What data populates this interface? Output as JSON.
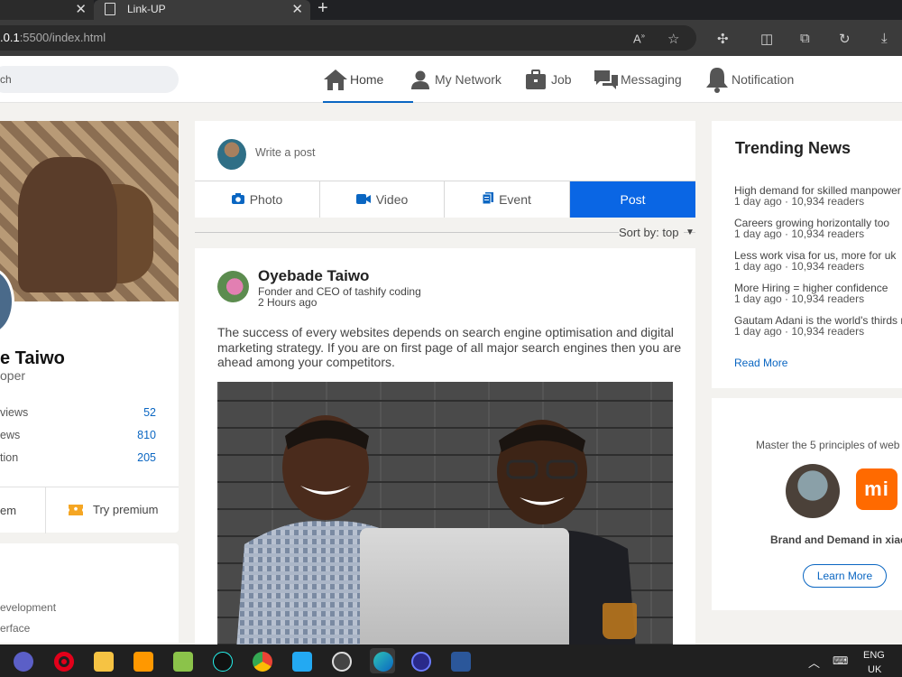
{
  "browser": {
    "tab_title": "Link-UP",
    "url_host": ".0.1",
    "url_rest": ":5500/index.html"
  },
  "search": {
    "placeholder": "ch"
  },
  "nav": {
    "home": "Home",
    "network": "My Network",
    "job": "Job",
    "messaging": "Messaging",
    "notification": "Notification"
  },
  "profile": {
    "name": "e Taiwo",
    "role": "oper",
    "stats": [
      {
        "label": "views",
        "value": "52"
      },
      {
        "label": "ews",
        "value": "810"
      },
      {
        "label": "tion",
        "value": "205"
      }
    ],
    "items_label": "em",
    "premium_label": "Try premium",
    "skills": [
      "evelopment",
      "erface"
    ]
  },
  "composer": {
    "placeholder": "Write a post",
    "photo": "Photo",
    "video": "Video",
    "event": "Event",
    "post": "Post"
  },
  "sort": {
    "label": "Sort by: top"
  },
  "post": {
    "author": "Oyebade Taiwo",
    "headline": "Fonder and CEO of tashify coding",
    "time": "2 Hours ago",
    "text": "The success of every websites depends on search engine optimisation and digital marketing strategy. If you are on first page of all major search engines then you are ahead among your competitors."
  },
  "trending": {
    "title": "Trending News",
    "items": [
      {
        "headline": "High demand for skilled manpower",
        "meta": "1 day ago · 10,934 readers"
      },
      {
        "headline": "Careers growing horizontally too",
        "meta": "1 day ago · 10,934 readers"
      },
      {
        "headline": "Less work visa for us, more for uk",
        "meta": "1 day ago · 10,934 readers"
      },
      {
        "headline": "More Hiring = higher confidence",
        "meta": "1 day ago · 10,934 readers"
      },
      {
        "headline": "Gautam Adani is the world's thirds r",
        "meta": "1 day ago · 10,934 readers"
      }
    ],
    "read_more": "Read More"
  },
  "promo": {
    "text": "Master the 5 principles of web",
    "logo_text": "mi",
    "brand": "Brand and Demand in xiac",
    "learn_more": "Learn More"
  },
  "taskbar": {
    "lang": "ENG",
    "region": "UK"
  },
  "colors": {
    "accent": "#0a66c2",
    "post_button": "#0a66e4",
    "xiaomi": "#ff6a00"
  }
}
